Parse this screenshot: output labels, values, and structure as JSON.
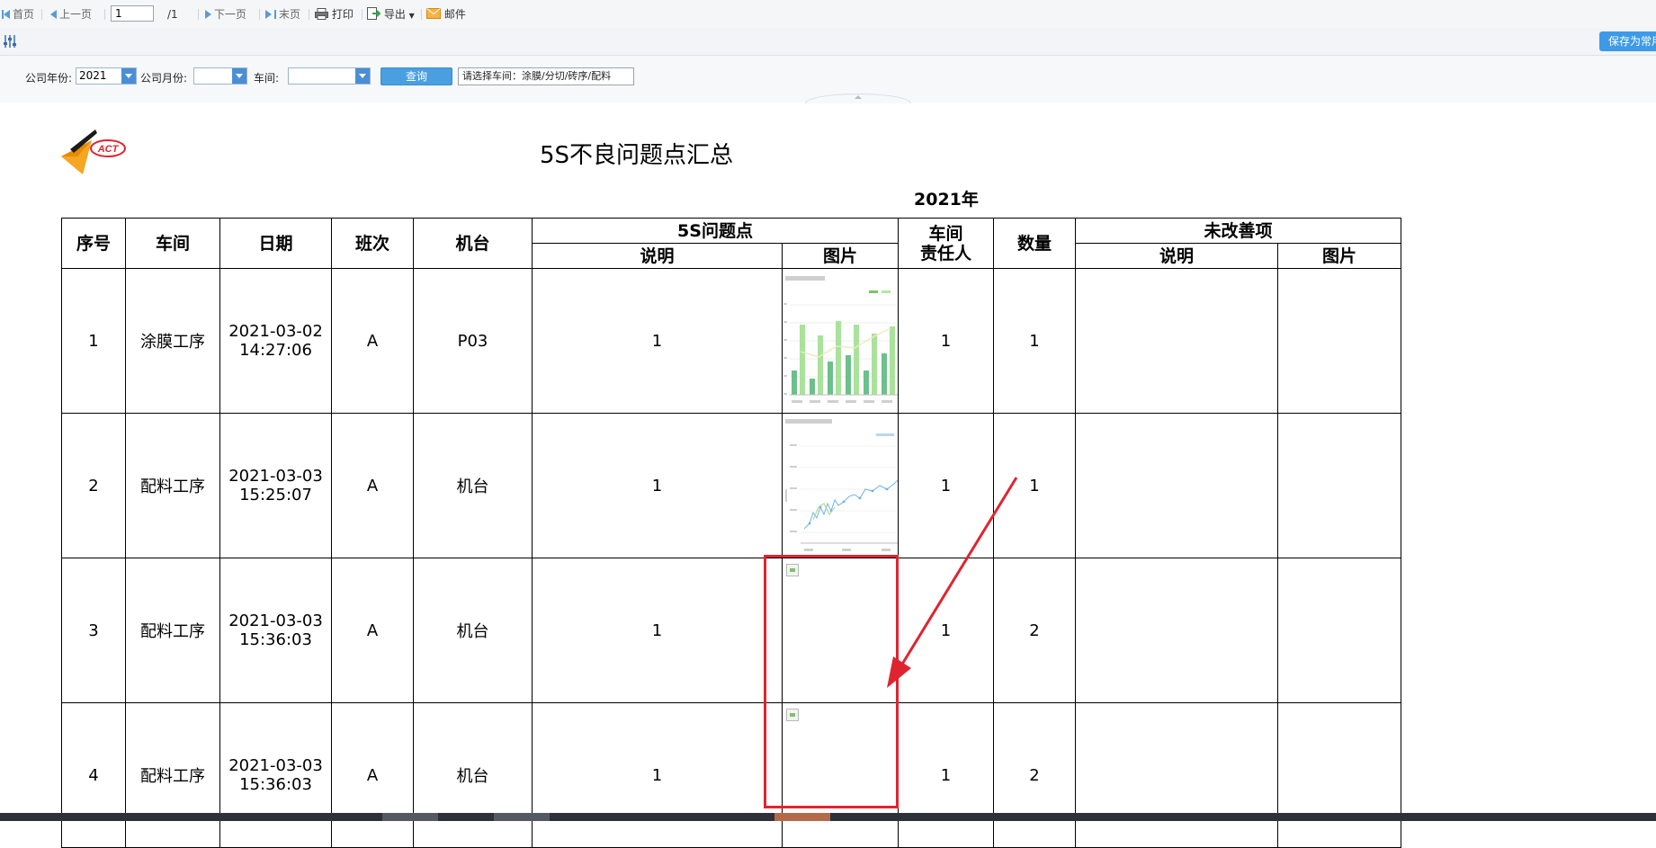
{
  "toolbar": {
    "first_page": "首页",
    "prev_page": "上一页",
    "page_number": "1",
    "page_total": "/1",
    "next_page": "下一页",
    "last_page": "末页",
    "print": "打印",
    "export": "导出",
    "mail": "邮件"
  },
  "filters": {
    "year_label": "公司年份:",
    "year_value": "2021",
    "month_label": "公司月份:",
    "month_value": "",
    "workshop_label": "车间:",
    "workshop_value": "",
    "query_button": "查询",
    "hint": "请选择车间：涂膜/分切/砖序/配料",
    "save_button": "保存为常用"
  },
  "report": {
    "title": "5S不良问题点汇总",
    "year": "2021年",
    "logo_text": "ACT",
    "headers": {
      "index": "序号",
      "workshop": "车间",
      "date": "日期",
      "shift": "班次",
      "machine": "机台",
      "issue_group": "5S问题点",
      "issue_desc": "说明",
      "issue_pic": "图片",
      "owner_l1": "车间",
      "owner_l2": "责任人",
      "quantity": "数量",
      "pending_group": "未改善项",
      "pending_desc": "说明",
      "pending_pic": "图片"
    },
    "rows": [
      {
        "index": "1",
        "workshop": "涂膜工序",
        "date": "2021-03-02",
        "time": "14:27:06",
        "shift": "A",
        "machine": "P03",
        "desc": "1",
        "pic": "bar-chart-thumbnail",
        "owner": "1",
        "qty": "1"
      },
      {
        "index": "2",
        "workshop": "配料工序",
        "date": "2021-03-03",
        "time": "15:25:07",
        "shift": "A",
        "machine": "机台",
        "desc": "1",
        "pic": "line-chart-thumbnail",
        "owner": "1",
        "qty": "1"
      },
      {
        "index": "3",
        "workshop": "配料工序",
        "date": "2021-03-03",
        "time": "15:36:03",
        "shift": "A",
        "machine": "机台",
        "desc": "1",
        "pic": "broken-image-icon",
        "owner": "1",
        "qty": "2"
      },
      {
        "index": "4",
        "workshop": "配料工序",
        "date": "2021-03-03",
        "time": "15:36:03",
        "shift": "A",
        "machine": "机台",
        "desc": "1",
        "pic": "broken-image-icon",
        "owner": "1",
        "qty": "2"
      }
    ]
  },
  "colors": {
    "accent_blue": "#4a9fe0",
    "annotation_red": "#e0242f",
    "thumb_green": "#8fd680"
  }
}
